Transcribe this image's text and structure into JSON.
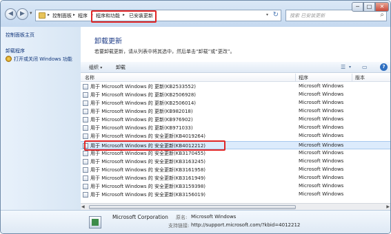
{
  "address": {
    "crumbs": [
      "控制面板",
      "程序",
      "程序和功能",
      "已安装更新"
    ],
    "search_placeholder": "搜索 已安装更新"
  },
  "window_controls": {
    "minimize": "─",
    "maximize": "□",
    "close": "✕"
  },
  "sidebar": {
    "links": [
      {
        "label": "控制面板主页"
      },
      {
        "label": "卸载程序"
      },
      {
        "label": "打开或关闭 Windows 功能"
      }
    ]
  },
  "main": {
    "title": "卸载更新",
    "description": "若要卸载更新，请从列表中将其选中，然后单击“卸载”或“更改”。"
  },
  "toolbar": {
    "organize": "组织",
    "uninstall": "卸载"
  },
  "columns": {
    "name": "名称",
    "program": "程序",
    "version": "版本"
  },
  "rows": [
    {
      "name": "用于 Microsoft Windows 的 更新(KB2533552)",
      "program": "Microsoft Windows"
    },
    {
      "name": "用于 Microsoft Windows 的 更新(KB2506928)",
      "program": "Microsoft Windows"
    },
    {
      "name": "用于 Microsoft Windows 的 更新(KB2506014)",
      "program": "Microsoft Windows"
    },
    {
      "name": "用于 Microsoft Windows 的 更新(KB982018)",
      "program": "Microsoft Windows"
    },
    {
      "name": "用于 Microsoft Windows 的 更新(KB976902)",
      "program": "Microsoft Windows"
    },
    {
      "name": "用于 Microsoft Windows 的 更新(KB971033)",
      "program": "Microsoft Windows"
    },
    {
      "name": "用于 Microsoft Windows 的 安全更新(KB4019264)",
      "program": "Microsoft Windows"
    },
    {
      "name": "用于 Microsoft Windows 的 安全更新(KB4012212)",
      "program": "Microsoft Windows"
    },
    {
      "name": "用于 Microsoft Windows 的 安全更新(KB3170455)",
      "program": "Microsoft Windows"
    },
    {
      "name": "用于 Microsoft Windows 的 安全更新(KB3163245)",
      "program": "Microsoft Windows"
    },
    {
      "name": "用于 Microsoft Windows 的 安全更新(KB3161958)",
      "program": "Microsoft Windows"
    },
    {
      "name": "用于 Microsoft Windows 的 安全更新(KB3161949)",
      "program": "Microsoft Windows"
    },
    {
      "name": "用于 Microsoft Windows 的 安全更新(KB3159398)",
      "program": "Microsoft Windows"
    },
    {
      "name": "用于 Microsoft Windows 的 安全更新(KB3156019)",
      "program": "Microsoft Windows"
    }
  ],
  "selected_row": 7,
  "details": {
    "publisher": "Microsoft Corporation",
    "parent_label": "原名:",
    "parent_value": "Microsoft Windows",
    "support_label": "支持链接:",
    "support_value": "http://support.microsoft.com/?kbid=4012212"
  },
  "colors": {
    "highlight": "#e02424",
    "selection": "#dcebfc",
    "link": "#10357a"
  }
}
